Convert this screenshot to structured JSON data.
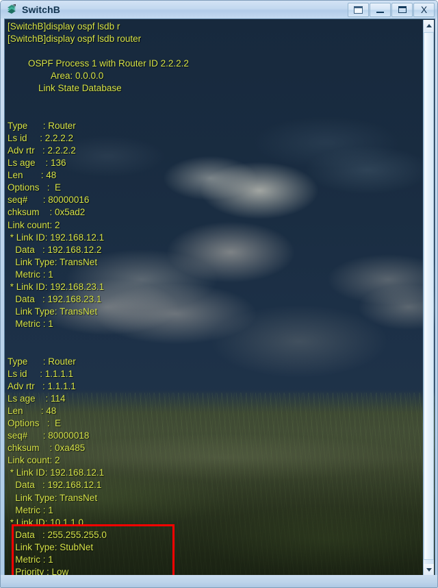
{
  "window": {
    "title": "SwitchB",
    "icon": "terminal-app-icon",
    "controls": [
      {
        "name": "restore-button",
        "label": "Restore"
      },
      {
        "name": "minimize-button",
        "label": "Minimize"
      },
      {
        "name": "maximize-button",
        "label": "Maximize"
      },
      {
        "name": "close-button",
        "label": "X"
      }
    ]
  },
  "colors": {
    "terminal_background": "#1a2d42",
    "terminal_text": "#d8e64b",
    "annotation_box": "#fe0000",
    "titlebar": "#c2d8ef"
  },
  "scrollbar": {
    "up_arrow": "scroll-up-arrow",
    "down_arrow": "scroll-down-arrow",
    "thumb": "scroll-thumb"
  },
  "terminal": {
    "prompt_lines": [
      "[SwitchB]display ospf lsdb r",
      "[SwitchB]display ospf lsdb router"
    ],
    "header": {
      "line1": "        OSPF Process 1 with Router ID 2.2.2.2",
      "line2": "                 Area: 0.0.0.0",
      "line3": "            Link State Database"
    },
    "lsa_blocks": [
      {
        "fields": [
          "Type      : Router",
          "Ls id     : 2.2.2.2",
          "Adv rtr   : 2.2.2.2",
          "Ls age    : 136",
          "Len       : 48",
          "Options   :  E",
          "seq#      : 80000016",
          "chksum    : 0x5ad2",
          "Link count: 2"
        ],
        "links": [
          [
            " * Link ID: 192.168.12.1",
            "   Data   : 192.168.12.2",
            "   Link Type: TransNet",
            "   Metric : 1"
          ],
          [
            " * Link ID: 192.168.23.1",
            "   Data   : 192.168.23.1",
            "   Link Type: TransNet",
            "   Metric : 1"
          ]
        ]
      },
      {
        "fields": [
          "Type      : Router",
          "Ls id     : 1.1.1.1",
          "Adv rtr   : 1.1.1.1",
          "Ls age    : 114",
          "Len       : 48",
          "Options   :  E",
          "seq#      : 80000018",
          "chksum    : 0xa485",
          "Link count: 2"
        ],
        "links": [
          [
            " * Link ID: 192.168.12.1",
            "   Data   : 192.168.12.1",
            "   Link Type: TransNet",
            "   Metric : 1"
          ],
          [
            " * Link ID: 10.1.1.0",
            "   Data   : 255.255.255.0",
            "   Link Type: StubNet",
            "   Metric : 1",
            "   Priority : Low"
          ]
        ]
      }
    ]
  },
  "annotation": {
    "label": "highlighted-stubnet-link",
    "color": "#fe0000"
  }
}
